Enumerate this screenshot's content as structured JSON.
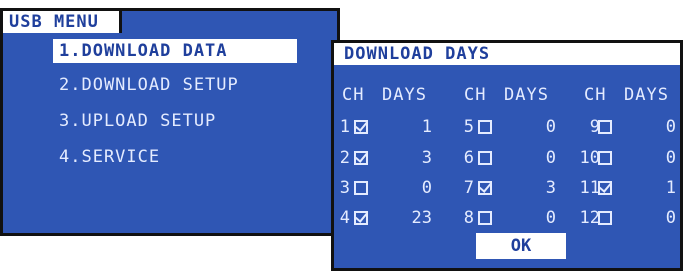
{
  "usb_menu": {
    "title": "USB MENU",
    "items": [
      {
        "label": "1.DOWNLOAD DATA",
        "selected": true
      },
      {
        "label": "2.DOWNLOAD SETUP",
        "selected": false
      },
      {
        "label": "3.UPLOAD SETUP",
        "selected": false
      },
      {
        "label": "4.SERVICE",
        "selected": false
      }
    ]
  },
  "download_days": {
    "title": "DOWNLOAD DAYS",
    "header_ch": "CH",
    "header_days": "DAYS",
    "channels": [
      {
        "ch": "1",
        "checked": true,
        "days": "1"
      },
      {
        "ch": "2",
        "checked": true,
        "days": "3"
      },
      {
        "ch": "3",
        "checked": false,
        "days": "0"
      },
      {
        "ch": "4",
        "checked": true,
        "days": "23"
      },
      {
        "ch": "5",
        "checked": false,
        "days": "0"
      },
      {
        "ch": "6",
        "checked": false,
        "days": "0"
      },
      {
        "ch": "7",
        "checked": true,
        "days": "3"
      },
      {
        "ch": "8",
        "checked": false,
        "days": "0"
      },
      {
        "ch": "9",
        "checked": false,
        "days": "0"
      },
      {
        "ch": "10",
        "checked": false,
        "days": "0"
      },
      {
        "ch": "11",
        "checked": true,
        "days": "1"
      },
      {
        "ch": "12",
        "checked": false,
        "days": "0"
      }
    ],
    "ok_label": "OK"
  },
  "colors": {
    "panel_bg": "#2f56b4",
    "text": "#e4ebff",
    "highlight_bg": "#ffffff",
    "highlight_text": "#1f3f9c",
    "border": "#111111"
  }
}
